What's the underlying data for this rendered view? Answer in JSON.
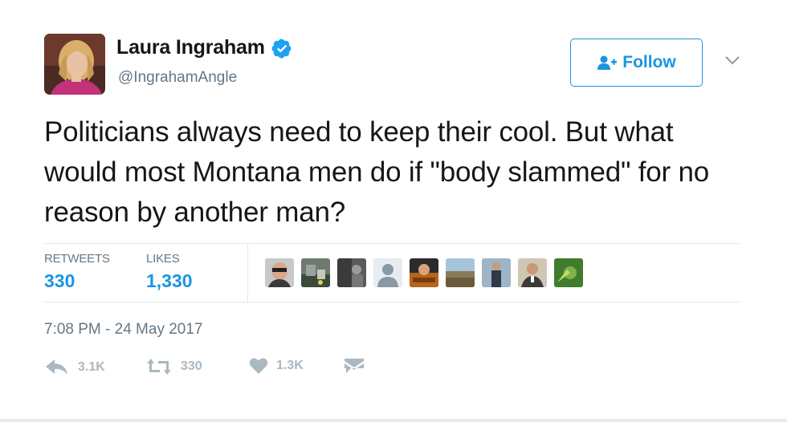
{
  "author": {
    "name": "Laura Ingraham",
    "handle": "@IngrahamAngle",
    "verified_icon": "verified-badge-icon"
  },
  "follow_button": {
    "label": "Follow",
    "icon": "add-user-icon"
  },
  "tweet": {
    "text": "Politicians always need to keep their cool. But what would most Montana men do if \"body slammed\" for no reason by another man?"
  },
  "stats": {
    "retweets_label": "RETWEETS",
    "retweets_value": "330",
    "likes_label": "LIKES",
    "likes_value": "1,330"
  },
  "timestamp": "7:08 PM - 24 May 2017",
  "actions": {
    "reply_count": "3.1K",
    "retweet_count": "330",
    "like_count": "1.3K"
  },
  "colors": {
    "accent": "#1b95e0",
    "muted": "#657786",
    "action_gray": "#aab8c2",
    "divider": "#e1e8ed"
  }
}
